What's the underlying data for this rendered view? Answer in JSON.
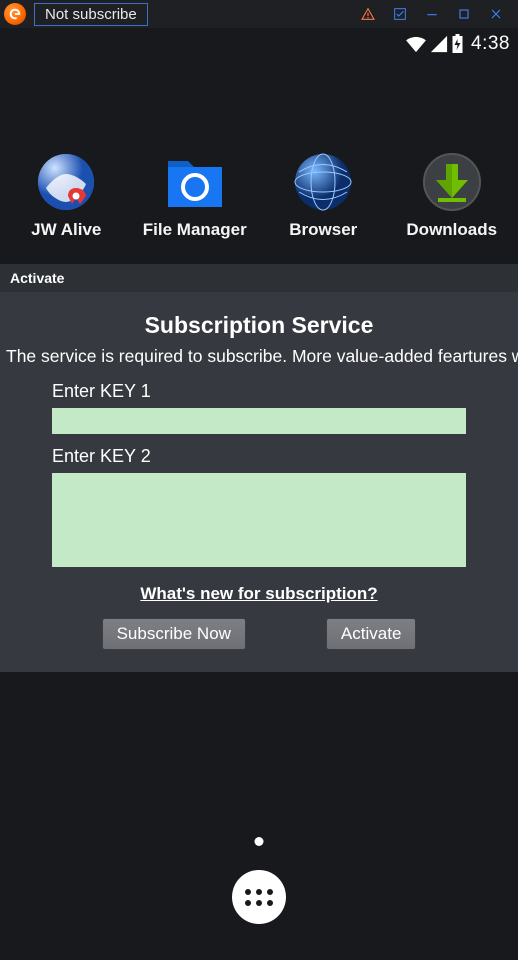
{
  "window": {
    "title": "Not subscribe"
  },
  "status": {
    "time": "4:38"
  },
  "apps": [
    {
      "label": "JW Alive"
    },
    {
      "label": "File Manager"
    },
    {
      "label": "Browser"
    },
    {
      "label": "Downloads"
    }
  ],
  "panel": {
    "tab": "Activate",
    "title": "Subscription Service",
    "description": "The service is required to subscribe. More value-added feartures will be unlocked after subscription",
    "key1_label": "Enter KEY 1",
    "key2_label": "Enter KEY 2",
    "whats_new": "What's new for subscription?",
    "subscribe_btn": "Subscribe Now",
    "activate_btn": "Activate"
  }
}
